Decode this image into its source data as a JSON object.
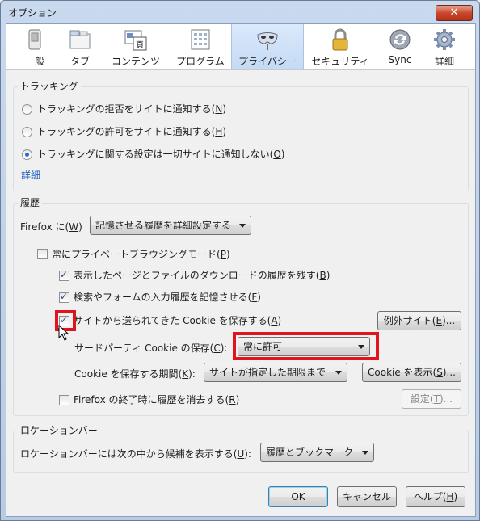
{
  "window": {
    "title": "オプション",
    "close_label": "✕"
  },
  "toolbar": {
    "items": [
      {
        "label": "一般",
        "icon": "switch-icon"
      },
      {
        "label": "タブ",
        "icon": "tabs-icon"
      },
      {
        "label": "コンテンツ",
        "icon": "content-icon"
      },
      {
        "label": "プログラム",
        "icon": "applications-icon"
      },
      {
        "label": "プライバシー",
        "icon": "mask-icon",
        "active": true
      },
      {
        "label": "セキュリティ",
        "icon": "lock-icon"
      },
      {
        "label": "Sync",
        "icon": "sync-icon"
      },
      {
        "label": "詳細",
        "icon": "gear-icon"
      }
    ]
  },
  "tracking": {
    "title": "トラッキング",
    "options": [
      {
        "text": "トラッキングの拒否をサイトに通知する(",
        "key": "N",
        "selected": false
      },
      {
        "text": "トラッキングの許可をサイトに通知する(",
        "key": "H",
        "selected": false
      },
      {
        "text": "トラッキングに関する設定は一切サイトに通知しない(",
        "key": "O",
        "selected": true
      }
    ],
    "details_link": "詳細"
  },
  "history": {
    "title": "履歴",
    "firefox_label_pre": "Firefox に(",
    "firefox_label_key": "W",
    "mode_value": "記憶させる履歴を詳細設定する",
    "private_mode": {
      "text": "常にプライベートブラウジングモード(",
      "key": "P",
      "checked": false
    },
    "keep_pages": {
      "text": "表示したページとファイルのダウンロードの履歴を残す(",
      "key": "B",
      "checked": true
    },
    "remember_forms": {
      "text": "検索やフォームの入力履歴を記憶させる(",
      "key": "F",
      "checked": true
    },
    "accept_cookies": {
      "text": "サイトから送られてきた Cookie を保存する(",
      "key": "A",
      "checked": true
    },
    "exceptions_button": {
      "text": "例外サイト(",
      "key": "E",
      "suffix": ")..."
    },
    "third_party_label": {
      "text": "サードパーティ Cookie の保存(",
      "key": "C",
      "suffix": "):"
    },
    "third_party_value": "常に許可",
    "keep_until_label": {
      "text": "Cookie を保存する期間(",
      "key": "K",
      "suffix": "):"
    },
    "keep_until_value": "サイトが指定した期限まで",
    "show_cookies_button": {
      "text": "Cookie を表示(",
      "key": "S",
      "suffix": ")..."
    },
    "clear_on_close": {
      "text": "Firefox の終了時に履歴を消去する(",
      "key": "R",
      "checked": false
    },
    "settings_button": {
      "text": "設定(",
      "key": "T",
      "suffix": ")..."
    }
  },
  "location_bar": {
    "title": "ロケーションバー",
    "label": {
      "text": "ロケーションバーには次の中から候補を表示する(",
      "key": "U",
      "suffix": "):"
    },
    "value": "履歴とブックマーク"
  },
  "footer": {
    "ok": "OK",
    "cancel": "キャンセル",
    "help": {
      "text": "ヘルプ(",
      "key": "H",
      "suffix": ")"
    }
  },
  "colors": {
    "highlight": "#e0141c",
    "link": "#1e5fbf",
    "titlebar": "#c9d9ee"
  }
}
